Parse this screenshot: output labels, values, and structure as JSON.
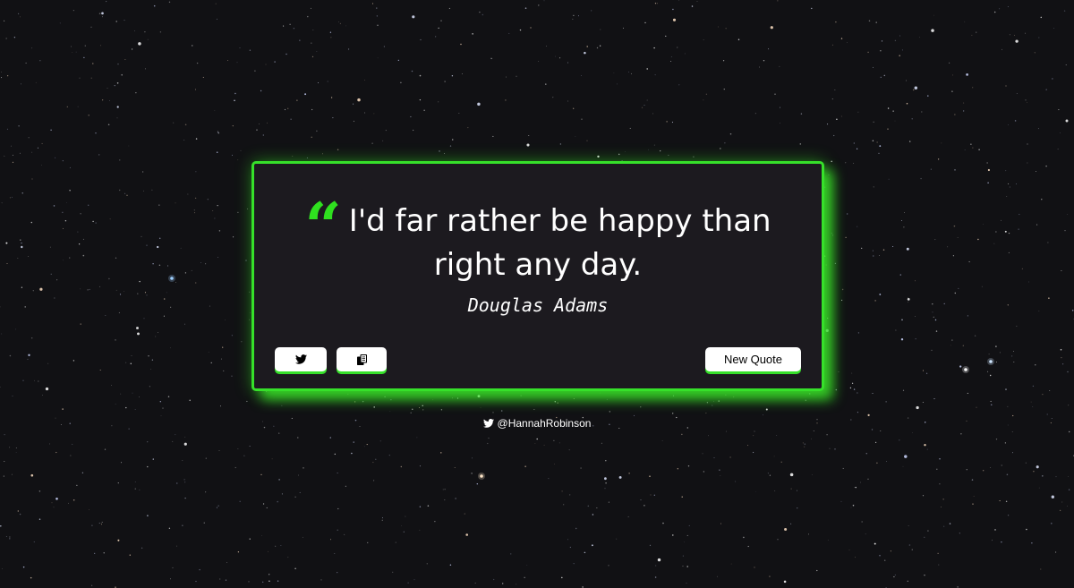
{
  "quote": {
    "mark_icon": "quote-left-icon",
    "text": "I'd far rather be happy than right any day.",
    "author": "Douglas Adams"
  },
  "actions": {
    "tweet_icon": "twitter-icon",
    "copy_icon": "copy-icon",
    "new_quote_label": "New Quote"
  },
  "footer": {
    "icon": "twitter-icon",
    "handle": "@HannahRobinson"
  },
  "colors": {
    "accent": "#36e02a",
    "card_background": "#1c1a1f",
    "page_background": "#111114",
    "text": "#ffffff"
  }
}
